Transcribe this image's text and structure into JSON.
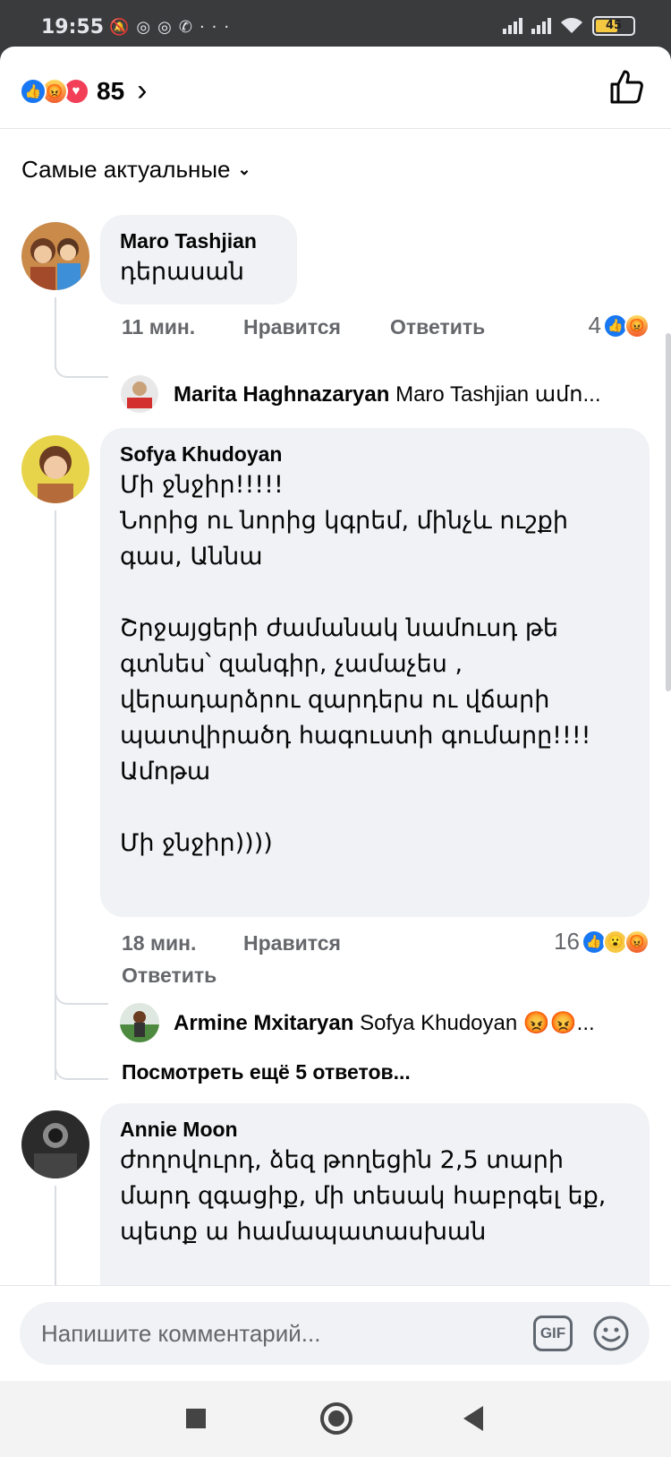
{
  "status_bar": {
    "time": "19:55",
    "notification_icons": [
      "mute-icon",
      "instagram-icon",
      "instagram-icon",
      "messenger-icon",
      "more-icon"
    ],
    "battery": "45"
  },
  "header": {
    "reactions": [
      "like",
      "angry",
      "love"
    ],
    "reaction_count": "85",
    "chevron": "›"
  },
  "sort": {
    "label": "Самые актуальные",
    "caret": "⌄"
  },
  "comments": [
    {
      "author": "Maro Tashjian",
      "text": "դերասան",
      "time": "11 мин.",
      "like_label": "Нравится",
      "reply_label": "Ответить",
      "reaction_count": "4",
      "reactions": [
        "like",
        "angry"
      ],
      "reply_preview": {
        "author": "Marita Haghnazaryan",
        "text": "Maro Tashjian ամո..."
      }
    },
    {
      "author": "Sofya Khudoyan",
      "text": "Մի ջնջիր!!!!!\nՆորից ու նորից կգրեմ, մինչև ուշքի գաս, Աննա\n\nՇրջայցերի ժամանակ նամուսդ թե գտնես՝ զանգիր, չամաչես ,\nվերադարձրու զարդերս ու վճարի պատվիրածդ հագուստի գումարը!!!!\nԱմոթա\n\nՄի ջնջիր))))",
      "time": "18 мин.",
      "like_label": "Нравится",
      "reply_label": "Ответить",
      "reaction_count": "16",
      "reactions": [
        "like",
        "wow",
        "angry"
      ],
      "reply_preview": {
        "author": "Armine Mxitaryan",
        "text": "Sofya Khudoyan 😡😡..."
      },
      "more_replies": "Посмотреть ещё 5 ответов..."
    },
    {
      "author": "Annie Moon",
      "text": "ժողովուրդ, ձեզ թողեցին 2,5 տարի մարդ զգացիք, մի տեսակ հաբրգել եք, պետք ա համապատասխան"
    }
  ],
  "composer": {
    "placeholder": "Напишите комментарий...",
    "gif_label": "GIF"
  },
  "colors": {
    "like": "#1877f2",
    "love": "#f33e58",
    "angry": "#f25c2c",
    "bubble": "#f0f2f5",
    "meta": "#65676b"
  }
}
